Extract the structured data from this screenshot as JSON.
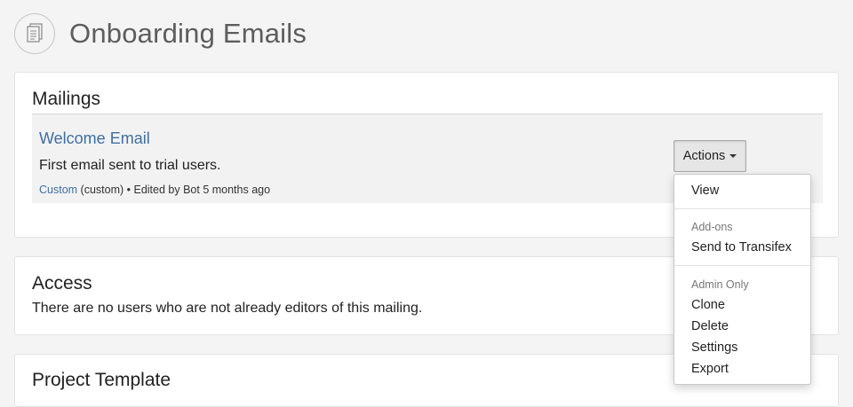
{
  "page": {
    "title": "Onboarding Emails"
  },
  "mailings": {
    "heading": "Mailings",
    "item": {
      "title": "Welcome Email",
      "description": "First email sent to trial users.",
      "meta_link": "Custom",
      "meta_rest": " (custom) • Edited by Bot 5 months ago"
    },
    "actions_label": "Actions"
  },
  "dropdown": {
    "view": "View",
    "addons_header": "Add-ons",
    "send_to_transifex": "Send to Transifex",
    "admin_header": "Admin Only",
    "clone": "Clone",
    "delete": "Delete",
    "settings": "Settings",
    "export": "Export"
  },
  "access": {
    "heading": "Access",
    "text": "There are no users who are not already editors of this mailing."
  },
  "template": {
    "heading": "Project Template"
  },
  "icons": {
    "page_icon": "documents-icon",
    "caret": "caret-down-icon"
  }
}
